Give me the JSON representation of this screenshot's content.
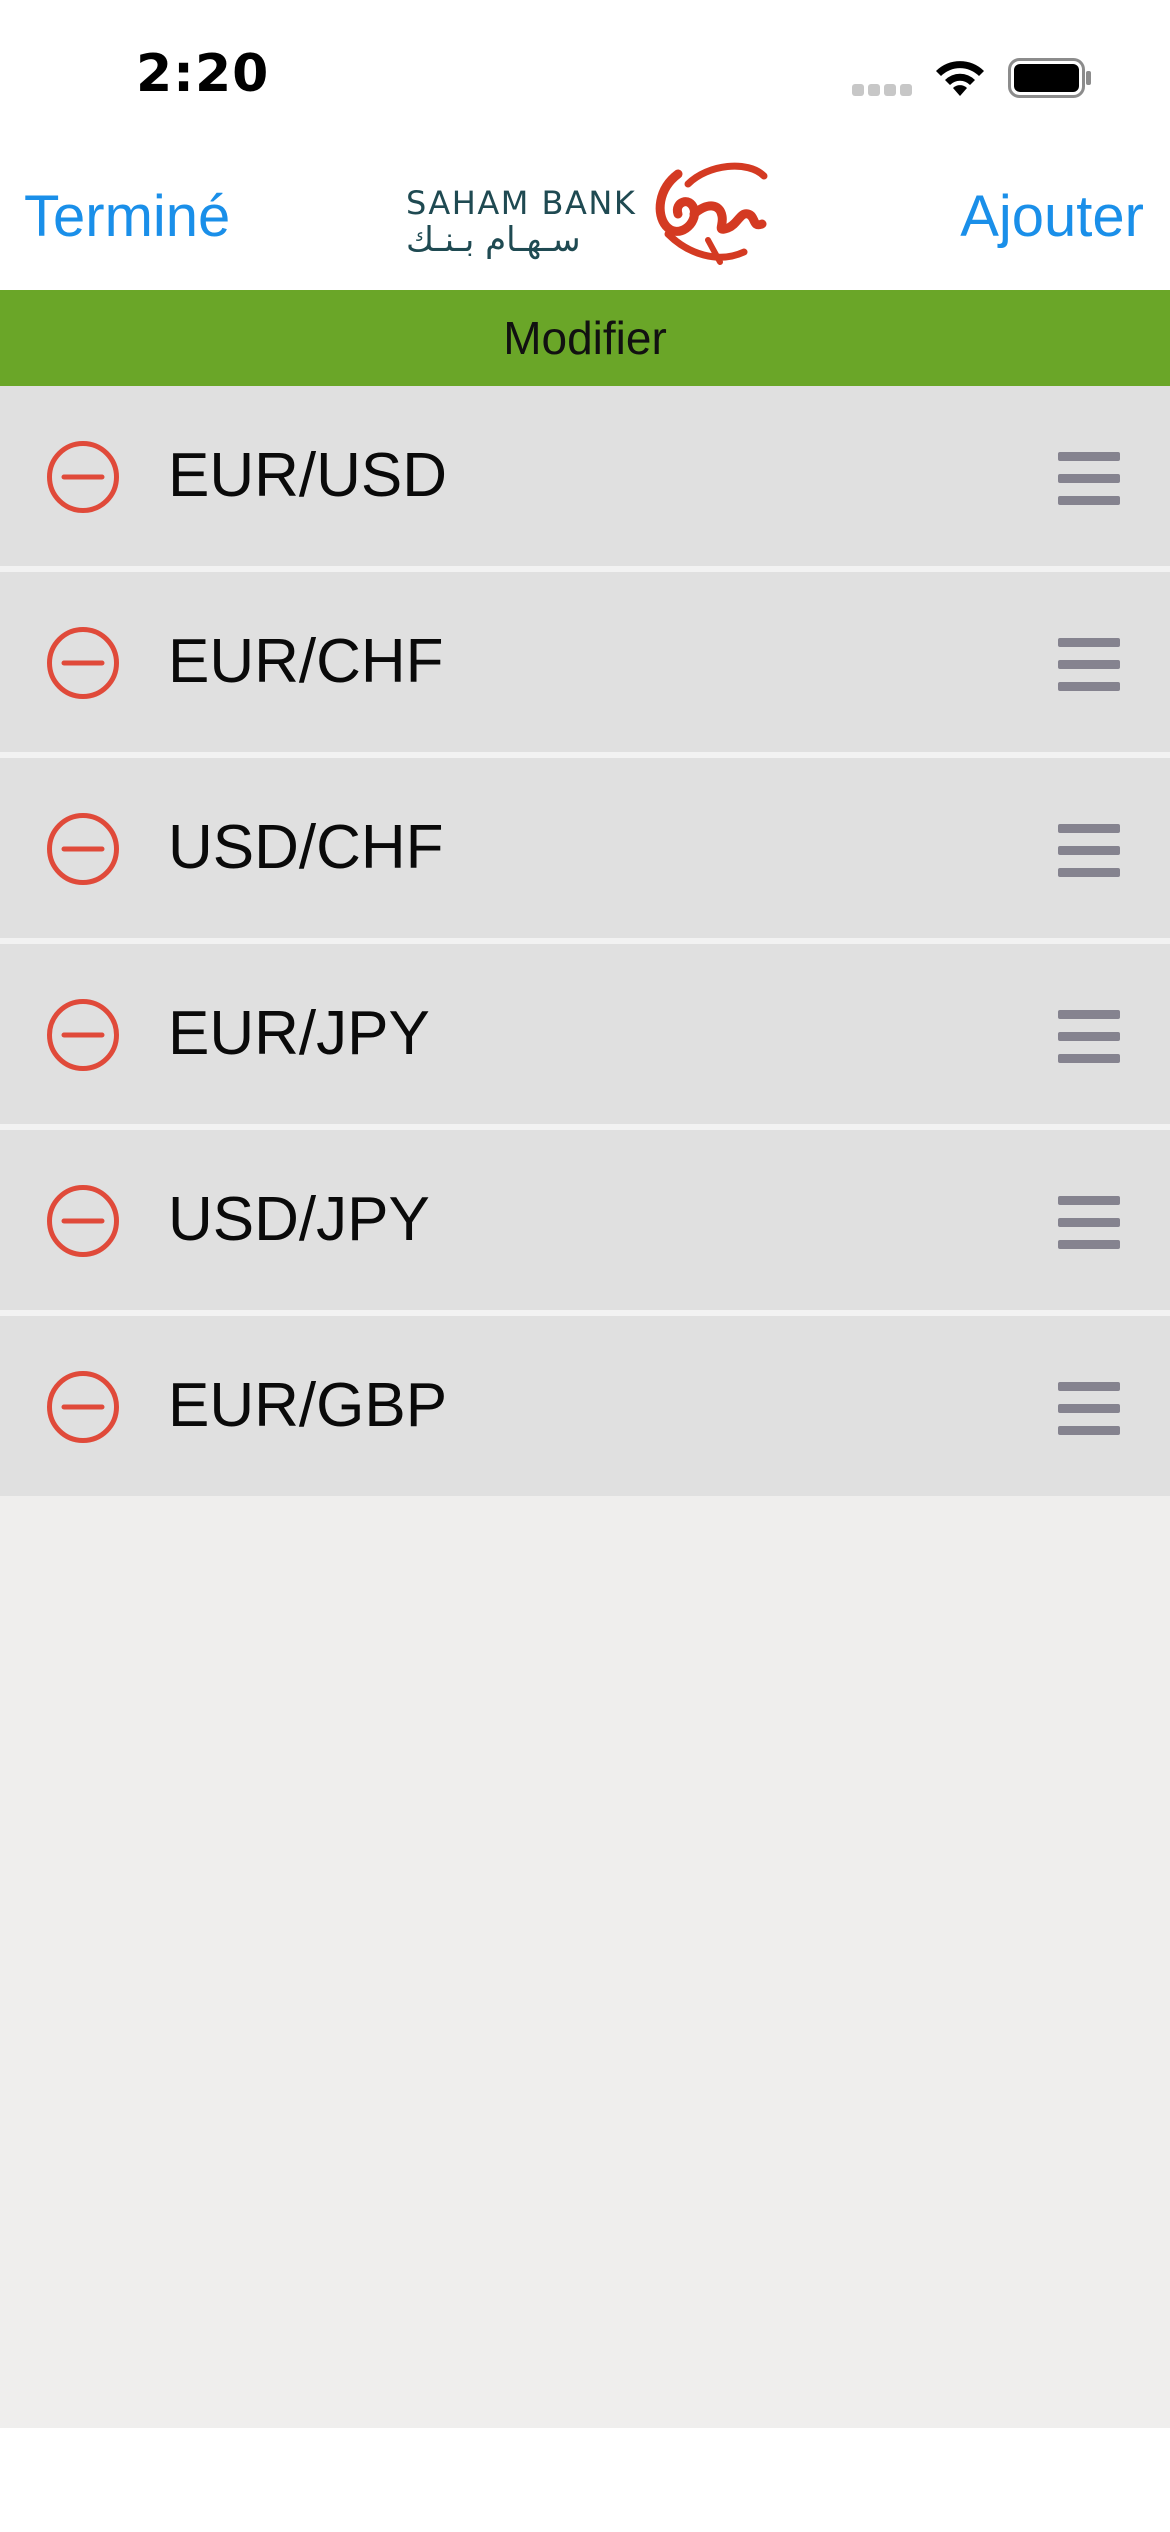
{
  "status_bar": {
    "time": "2:20"
  },
  "navbar": {
    "left_button": "Terminé",
    "right_button": "Ajouter",
    "logo": {
      "name_en": "SAHAM BANK",
      "name_ar": "سـهـام بـنـك"
    }
  },
  "section": {
    "title": "Modifier",
    "color": "#6aa628"
  },
  "list": {
    "items": [
      {
        "label": "EUR/USD"
      },
      {
        "label": "EUR/CHF"
      },
      {
        "label": "USD/CHF"
      },
      {
        "label": "EUR/JPY"
      },
      {
        "label": "USD/JPY"
      },
      {
        "label": "EUR/GBP"
      }
    ]
  },
  "colors": {
    "accent": "#1a8fe9",
    "delete": "#e04a3a",
    "handle": "#85838f",
    "row_bg": "#e0e0e0",
    "brand_red": "#d43a22",
    "brand_teal": "#1f4a52"
  }
}
